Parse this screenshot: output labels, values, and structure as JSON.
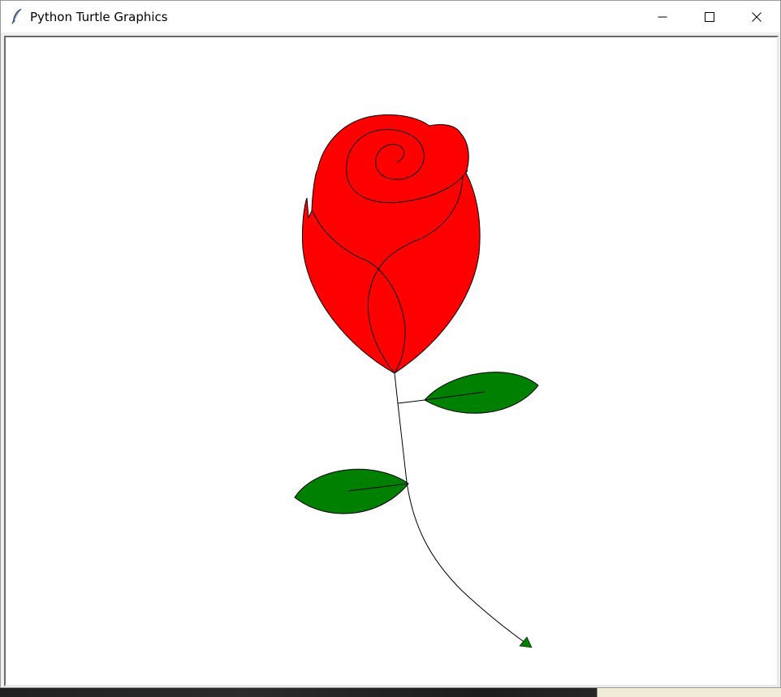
{
  "window": {
    "title": "Python Turtle Graphics",
    "app_icon": "feather-icon",
    "controls": {
      "minimize": "minimize-icon",
      "maximize": "maximize-icon",
      "close": "close-icon"
    }
  },
  "drawing": {
    "subject": "rose",
    "colors": {
      "petal_fill": "#ff0000",
      "outline": "#000000",
      "leaf_fill": "#008000",
      "turtle_fill": "#008000",
      "background": "#ffffff"
    }
  }
}
